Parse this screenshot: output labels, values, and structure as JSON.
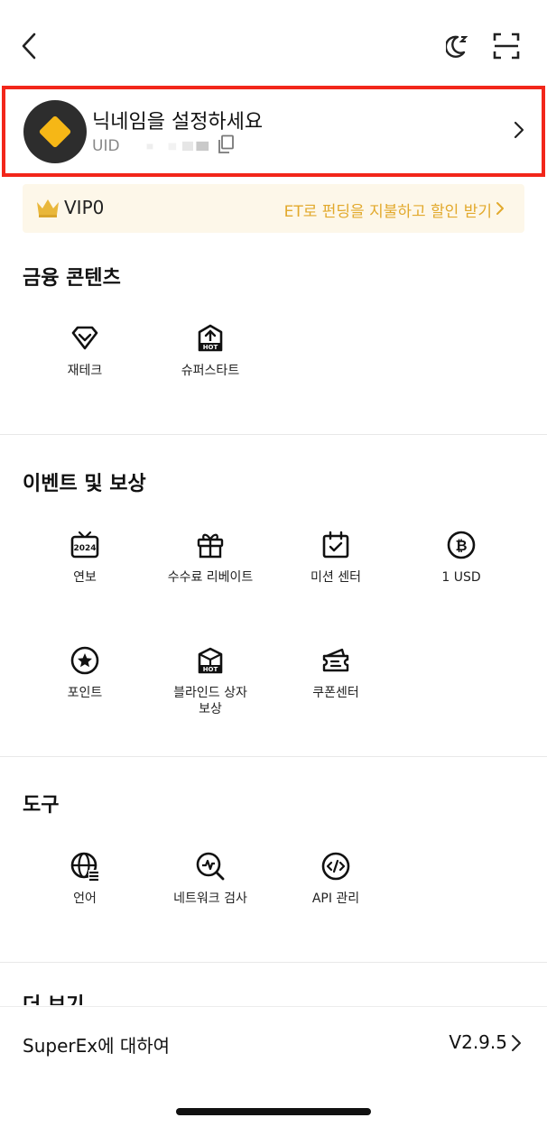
{
  "profile": {
    "nickname": "닉네임을 설정하세요",
    "uid_label": "UID"
  },
  "vip": {
    "level": "VIP0",
    "promo": "ET로 펀딩을 지불하고 할인 받기"
  },
  "sections": {
    "finance": {
      "title": "금융 콘텐츠",
      "items": [
        {
          "label": "재테크",
          "icon": "diamond-icon"
        },
        {
          "label": "슈퍼스타트",
          "icon": "hot-upload-icon"
        }
      ]
    },
    "events": {
      "title": "이벤트 및 보상",
      "items": [
        {
          "label": "연보",
          "icon": "tv-2024-icon"
        },
        {
          "label": "수수료 리베이트",
          "icon": "gift-icon"
        },
        {
          "label": "미션 센터",
          "icon": "calendar-check-icon"
        },
        {
          "label": "1 USD",
          "icon": "bitcoin-icon"
        },
        {
          "label": "포인트",
          "icon": "star-circle-icon"
        },
        {
          "label": "블라인드 상자\n보상",
          "icon": "hot-box-icon"
        },
        {
          "label": "쿠폰센터",
          "icon": "ticket-icon"
        }
      ]
    },
    "tools": {
      "title": "도구",
      "items": [
        {
          "label": "언어",
          "icon": "globe-icon"
        },
        {
          "label": "네트워크 검사",
          "icon": "network-search-icon"
        },
        {
          "label": "API 관리",
          "icon": "code-icon"
        }
      ]
    },
    "more": {
      "title": "더 보기"
    }
  },
  "about": {
    "label": "SuperEx에 대하여",
    "version": "V2.9.5"
  },
  "colors": {
    "highlight_border": "#f2261a",
    "brand_yellow": "#f6b716",
    "promo_text": "#e2a92c",
    "vip_background": "#fdf7e9"
  }
}
